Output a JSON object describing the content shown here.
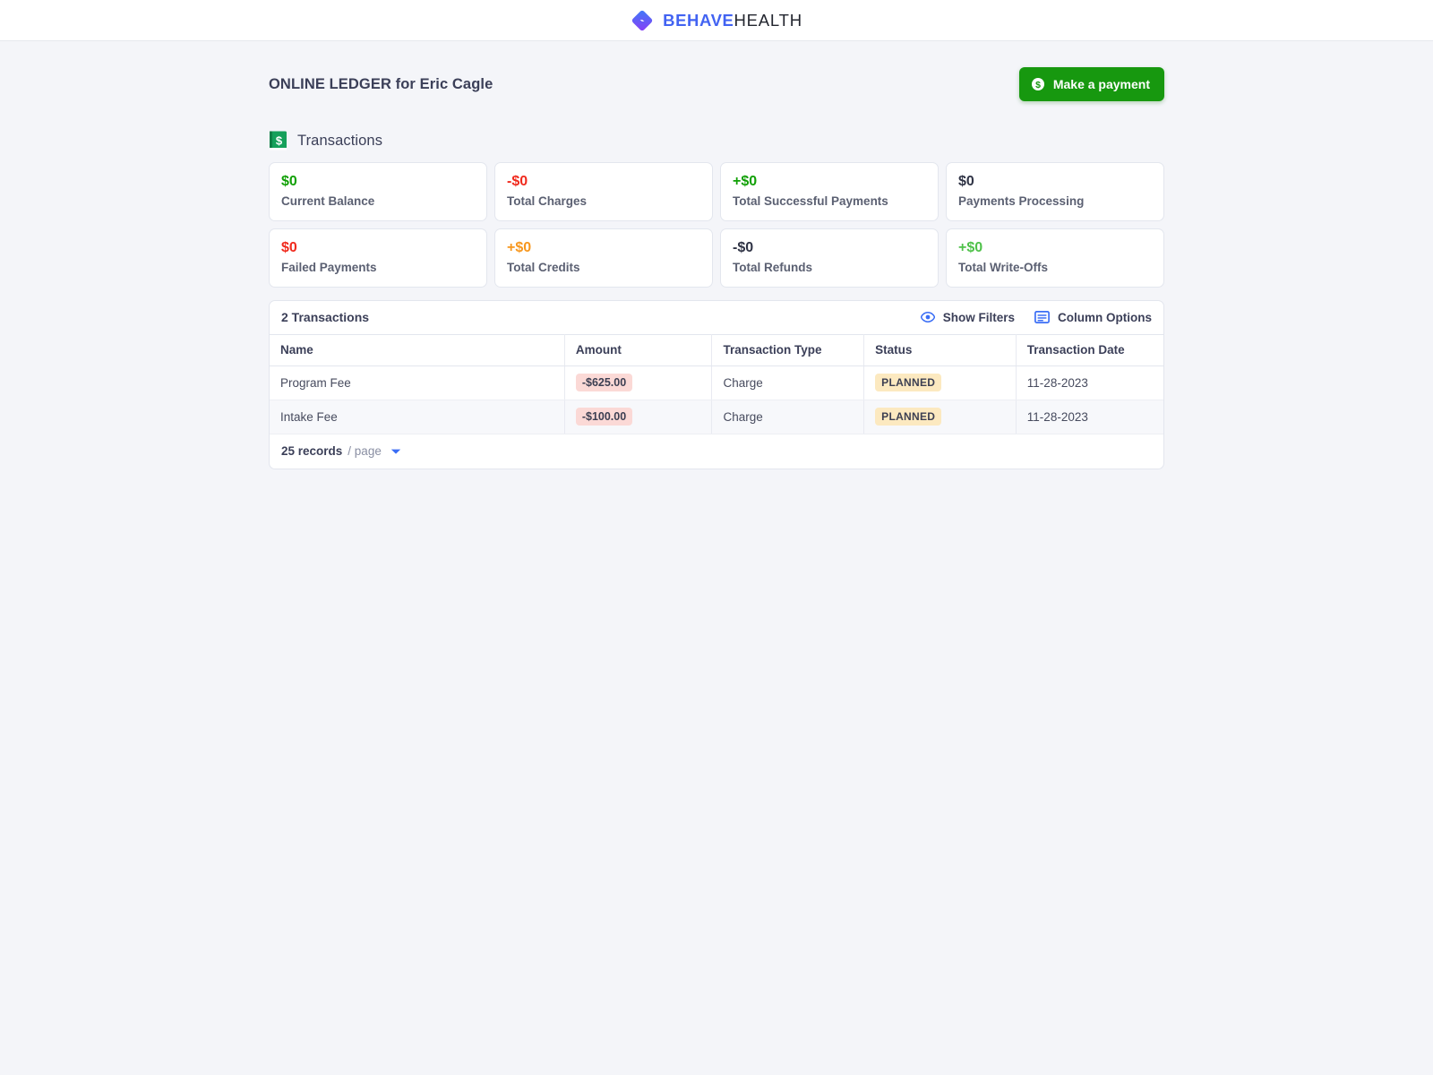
{
  "brand": {
    "logo_icon": "behave-diamond-logo",
    "name_primary": "BEHAVE",
    "name_secondary": "HEALTH",
    "primary_color": "#4263f2"
  },
  "header": {
    "title": "ONLINE LEDGER for Eric Cagle",
    "action_button": {
      "label": "Make a payment",
      "icon": "dollar-coin-icon",
      "color": "#17980f"
    }
  },
  "section": {
    "icon": "ledger-book-icon",
    "title": "Transactions"
  },
  "stats": [
    {
      "value": "$0",
      "label": "Current Balance",
      "color": "#11a006"
    },
    {
      "value": "-$0",
      "label": "Total Charges",
      "color": "#f02a1d"
    },
    {
      "value": "+$0",
      "label": "Total Successful Payments",
      "color": "#11a006"
    },
    {
      "value": "$0",
      "label": "Payments Processing",
      "color": "#2f3345"
    },
    {
      "value": "$0",
      "label": "Failed Payments",
      "color": "#f02a1d"
    },
    {
      "value": "+$0",
      "label": "Total Credits",
      "color": "#f7971e"
    },
    {
      "value": "-$0",
      "label": "Total Refunds",
      "color": "#2f3345"
    },
    {
      "value": "+$0",
      "label": "Total Write-Offs",
      "color": "#4fc14a"
    }
  ],
  "table": {
    "summary": "2 Transactions",
    "actions": {
      "show_filters": {
        "label": "Show Filters",
        "icon": "eye-icon"
      },
      "column_options": {
        "label": "Column Options",
        "icon": "columns-icon"
      }
    },
    "columns": [
      "Name",
      "Amount",
      "Transaction Type",
      "Status",
      "Transaction Date"
    ],
    "rows": [
      {
        "name": "Program Fee",
        "amount": "-$625.00",
        "type": "Charge",
        "status": "PLANNED",
        "date": "11-28-2023"
      },
      {
        "name": "Intake Fee",
        "amount": "-$100.00",
        "type": "Charge",
        "status": "PLANNED",
        "date": "11-28-2023"
      }
    ],
    "pagination": {
      "records": "25 records",
      "per_page": "/ page",
      "caret_icon": "chevron-down-icon"
    }
  }
}
